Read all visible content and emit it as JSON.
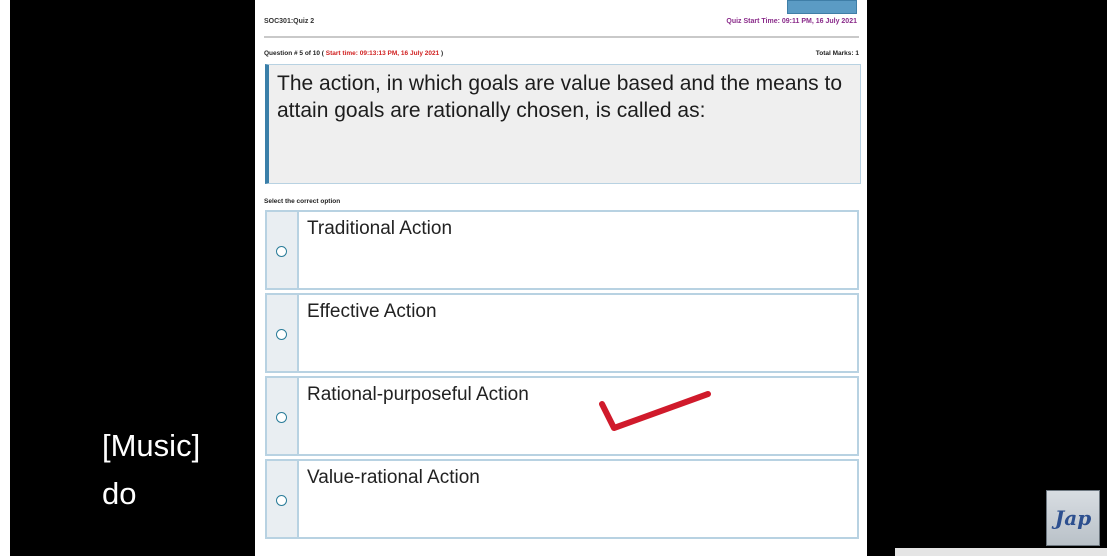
{
  "quiz": {
    "course_code": "SOC301:Quiz 2",
    "quiz_start_label": "Quiz Start Time: 09:11 PM, 16 July 2021",
    "question_label": "Question # 5 of 10 (",
    "start_time": "Start time: 09:13:13 PM, 16 July 2021",
    "question_label_end": ")",
    "total_marks": "Total Marks: 1",
    "question_text": "The action, in which goals are value based and the means to attain goals are rationally chosen, is called as:",
    "select_label": "Select the correct option",
    "options": [
      {
        "label": "Traditional Action"
      },
      {
        "label": "Effective Action"
      },
      {
        "label": "Rational-purposeful Action"
      },
      {
        "label": "Value-rational Action"
      }
    ],
    "checkmark_color": "#d01a2b"
  },
  "captions": [
    "[Music]",
    "do"
  ],
  "logo_text": "Jap",
  "colors": {
    "accent": "#3a7fa9",
    "border": "#b8d2e2",
    "header_purple": "#8a2b8a",
    "start_time_red": "#d02020"
  }
}
